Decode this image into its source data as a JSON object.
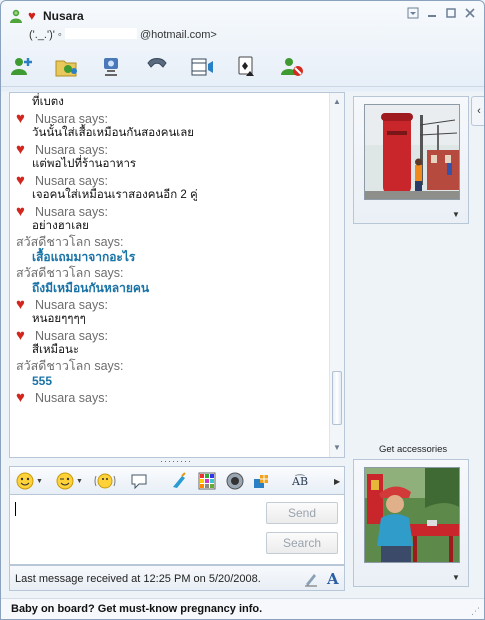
{
  "title": {
    "contact_name": "Nusara",
    "personal_message": "('._.')' ◦",
    "email_domain": "@hotmail.com>",
    "heart_glyph": "♥"
  },
  "window_controls": [
    "menu",
    "minimize",
    "maximize",
    "close"
  ],
  "toolbar": [
    {
      "name": "invite-contact-icon"
    },
    {
      "name": "send-files-icon"
    },
    {
      "name": "video-call-icon"
    },
    {
      "name": "voice-call-icon"
    },
    {
      "name": "activities-icon"
    },
    {
      "name": "games-icon"
    },
    {
      "name": "block-contact-icon"
    }
  ],
  "messages": [
    {
      "type": "text",
      "text": "ที่เบตง"
    },
    {
      "type": "says",
      "heart": true,
      "text": "Nusara says:"
    },
    {
      "type": "text",
      "text": "วันนั้นใส่เสื้อเหมือนกันสองคนเลย"
    },
    {
      "type": "says",
      "heart": true,
      "text": "Nusara says:"
    },
    {
      "type": "text",
      "text": "แต่พอไปที่ร้านอาหาร"
    },
    {
      "type": "says",
      "heart": true,
      "text": "Nusara says:"
    },
    {
      "type": "text",
      "text": "เจอคนใส่เหมือนเราสองคนอีก 2 คู่"
    },
    {
      "type": "says",
      "heart": true,
      "text": "Nusara says:"
    },
    {
      "type": "text",
      "text": "อย่างฮาเลย"
    },
    {
      "type": "says",
      "heart": false,
      "text": "สวัสดีชาวโลก says:"
    },
    {
      "type": "text-blue",
      "text": "เสื้อแถมมาจากอะไร"
    },
    {
      "type": "says",
      "heart": false,
      "text": "สวัสดีชาวโลก says:"
    },
    {
      "type": "text-blue",
      "text": "ถึงมีเหมือนกันหลายคน"
    },
    {
      "type": "says",
      "heart": true,
      "text": "Nusara says:"
    },
    {
      "type": "text",
      "text": "หนอยๆๆๆๆ"
    },
    {
      "type": "says",
      "heart": true,
      "text": "Nusara says:"
    },
    {
      "type": "text",
      "text": "สีเหมือนะ"
    },
    {
      "type": "says",
      "heart": false,
      "text": "สวัสดีชาวโลก says:"
    },
    {
      "type": "text-blue",
      "text": "555"
    },
    {
      "type": "says",
      "heart": true,
      "text": "Nusara says:"
    }
  ],
  "format_toolbar": {
    "font_label": "A͡B"
  },
  "input": {
    "value": ""
  },
  "buttons": {
    "send": "Send",
    "search": "Search"
  },
  "status": {
    "last_message": "Last message received at 12:25 PM on 5/20/2008."
  },
  "side": {
    "accessories_label": "Get accessories",
    "collapse_glyph": "‹"
  },
  "footer": {
    "ad_text": "Baby on board? Get must-know pregnancy info."
  }
}
